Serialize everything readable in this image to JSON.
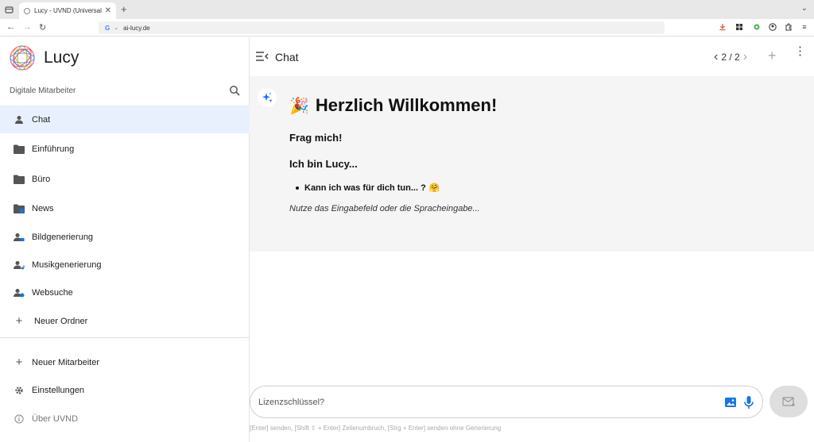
{
  "browser": {
    "tab_title": "Lucy - UVND (Universal V",
    "tab_close": "✕",
    "new_tab": "+",
    "url": "ai-lucy.de",
    "search_engine_letter": "G"
  },
  "sidebar": {
    "brand": "Lucy",
    "section_label": "Digitale Mitarbeiter",
    "items": [
      {
        "label": "Chat",
        "icon": "person-icon"
      },
      {
        "label": "Einführung",
        "icon": "folder-icon"
      },
      {
        "label": "Büro",
        "icon": "folder-icon"
      },
      {
        "label": "News",
        "icon": "news-icon"
      },
      {
        "label": "Bildgenerierung",
        "icon": "person-image-icon"
      },
      {
        "label": "Musikgenerierung",
        "icon": "person-music-icon"
      },
      {
        "label": "Websuche",
        "icon": "person-search-icon"
      },
      {
        "label": "Neuer Ordner",
        "icon": "plus-icon"
      }
    ],
    "bottom": [
      {
        "label": "Neuer Mitarbeiter",
        "icon": "plus-icon"
      },
      {
        "label": "Einstellungen",
        "icon": "gear-icon"
      },
      {
        "label": "Über UVND",
        "icon": "info-icon"
      }
    ]
  },
  "main": {
    "title": "Chat",
    "pager": "2 / 2",
    "message": {
      "heading_emoji": "🎉",
      "heading": "Herzlich Willkommen!",
      "line1": "Frag mich!",
      "line2": "Ich bin Lucy...",
      "bullet": "Kann ich was für dich tun... ?",
      "bullet_emoji": "🤗",
      "italic": "Nutze das Eingabefeld oder die Spracheingabe..."
    },
    "input": {
      "placeholder": "Lizenzschlüssel?",
      "hint": "[Enter] senden, [Shift ⇧ + Enter] Zeilenumbruch, [Strg + Enter] senden ohne Generierung"
    }
  },
  "colors": {
    "active_item_bg": "#e8f0fe",
    "message_bg": "#f5f5f5",
    "accent_blue": "#1a73e8"
  }
}
